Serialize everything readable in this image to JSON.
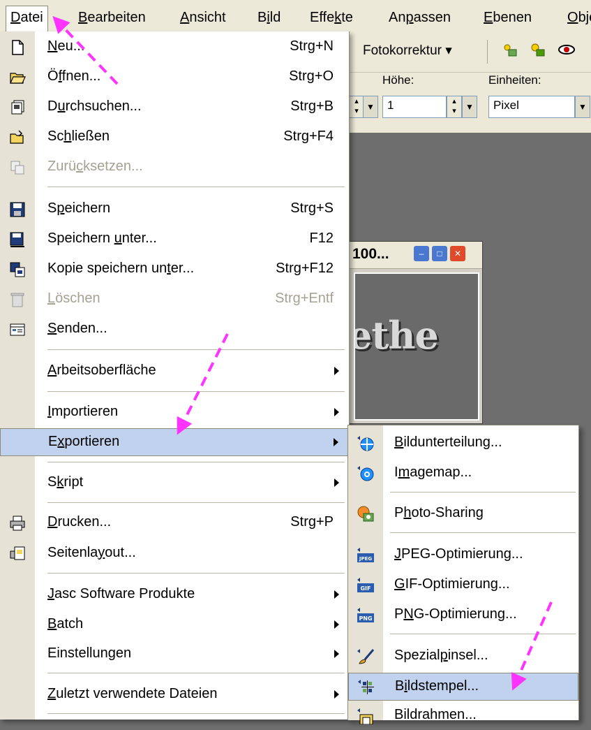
{
  "menubar": {
    "items": [
      {
        "pre": "",
        "u": "D",
        "post": "atei"
      },
      {
        "pre": "",
        "u": "B",
        "post": "earbeiten"
      },
      {
        "pre": "",
        "u": "A",
        "post": "nsicht"
      },
      {
        "pre": "B",
        "u": "i",
        "post": "ld"
      },
      {
        "pre": "Effe",
        "u": "k",
        "post": "te"
      },
      {
        "pre": "An",
        "u": "p",
        "post": "assen"
      },
      {
        "pre": "",
        "u": "E",
        "post": "benen"
      },
      {
        "pre": "",
        "u": "O",
        "post": "bje"
      }
    ]
  },
  "toolbar": {
    "fotokorrektur": "Fotokorrektur",
    "hoehe_label": "Höhe:",
    "hoehe_value": "1",
    "einheiten_label": "Einheiten:",
    "einheiten_value": "Pixel"
  },
  "document_window": {
    "title": "100...",
    "art_text": "ethe"
  },
  "file_menu": {
    "items": [
      {
        "pre": "",
        "u": "N",
        "post": "eu...",
        "shortcut": "Strg+N",
        "icon": "new-file-icon",
        "disabled": false,
        "submenu": false
      },
      {
        "pre": "Ö",
        "u": "f",
        "post": "fnen...",
        "shortcut": "Strg+O",
        "icon": "open-folder-icon",
        "disabled": false,
        "submenu": false
      },
      {
        "pre": "D",
        "u": "u",
        "post": "rchsuchen...",
        "shortcut": "Strg+B",
        "icon": "browse-icon",
        "disabled": false,
        "submenu": false
      },
      {
        "pre": "Sc",
        "u": "h",
        "post": "ließen",
        "shortcut": "Strg+F4",
        "icon": "close-folder-icon",
        "disabled": false,
        "submenu": false
      },
      {
        "pre": "Zurü",
        "u": "c",
        "post": "ksetzen...",
        "shortcut": "",
        "icon": "revert-icon",
        "disabled": true,
        "submenu": false
      },
      {
        "pre": "S",
        "u": "p",
        "post": "eichern",
        "shortcut": "Strg+S",
        "icon": "save-icon",
        "disabled": false,
        "submenu": false
      },
      {
        "pre": "Speichern ",
        "u": "u",
        "post": "nter...",
        "shortcut": "F12",
        "icon": "save-as-icon",
        "disabled": false,
        "submenu": false
      },
      {
        "pre": "Kopie speichern un",
        "u": "t",
        "post": "er...",
        "shortcut": "Strg+F12",
        "icon": "save-copy-icon",
        "disabled": false,
        "submenu": false
      },
      {
        "pre": "",
        "u": "L",
        "post": "öschen",
        "shortcut": "Strg+Entf",
        "icon": "trash-icon",
        "disabled": true,
        "submenu": false
      },
      {
        "pre": "",
        "u": "S",
        "post": "enden...",
        "shortcut": "",
        "icon": "send-icon",
        "disabled": false,
        "submenu": false
      },
      {
        "pre": "",
        "u": "A",
        "post": "rbeitsoberfläche",
        "shortcut": "",
        "icon": "",
        "disabled": false,
        "submenu": true
      },
      {
        "pre": "",
        "u": "I",
        "post": "mportieren",
        "shortcut": "",
        "icon": "",
        "disabled": false,
        "submenu": true
      },
      {
        "pre": "E",
        "u": "x",
        "post": "portieren",
        "shortcut": "",
        "icon": "",
        "disabled": false,
        "submenu": true,
        "highlight": true
      },
      {
        "pre": "S",
        "u": "k",
        "post": "ript",
        "shortcut": "",
        "icon": "",
        "disabled": false,
        "submenu": true
      },
      {
        "pre": "",
        "u": "D",
        "post": "rucken...",
        "shortcut": "Strg+P",
        "icon": "printer-icon",
        "disabled": false,
        "submenu": false
      },
      {
        "pre": "Seitenla",
        "u": "y",
        "post": "out...",
        "shortcut": "",
        "icon": "page-layout-icon",
        "disabled": false,
        "submenu": false
      },
      {
        "pre": "",
        "u": "J",
        "post": "asc Software Produkte",
        "shortcut": "",
        "icon": "",
        "disabled": false,
        "submenu": true
      },
      {
        "pre": "",
        "u": "B",
        "post": "atch",
        "shortcut": "",
        "icon": "",
        "disabled": false,
        "submenu": true
      },
      {
        "pre": "Einstellun",
        "u": "g",
        "post": "en",
        "shortcut": "",
        "icon": "",
        "disabled": false,
        "submenu": true
      },
      {
        "pre": "",
        "u": "Z",
        "post": "uletzt verwendete Dateien",
        "shortcut": "",
        "icon": "",
        "disabled": false,
        "submenu": true
      }
    ]
  },
  "export_submenu": {
    "items": [
      {
        "pre": "",
        "u": "B",
        "post": "ildunterteilung...",
        "icon": "image-slicer-icon"
      },
      {
        "pre": "I",
        "u": "m",
        "post": "agemap...",
        "icon": "imagemap-icon"
      },
      {
        "pre": "P",
        "u": "h",
        "post": "oto-Sharing",
        "icon": "photo-sharing-icon"
      },
      {
        "pre": "",
        "u": "J",
        "post": "PEG-Optimierung...",
        "icon": "jpeg-icon",
        "badge": "JPEG"
      },
      {
        "pre": "",
        "u": "G",
        "post": "IF-Optimierung...",
        "icon": "gif-icon",
        "badge": "GIF"
      },
      {
        "pre": "P",
        "u": "N",
        "post": "G-Optimierung...",
        "icon": "png-icon",
        "badge": "PNG"
      },
      {
        "pre": "Spezial",
        "u": "p",
        "post": "insel...",
        "icon": "brush-icon"
      },
      {
        "pre": "B",
        "u": "i",
        "post": "ldstempel...",
        "icon": "picture-tube-icon",
        "highlight": true
      },
      {
        "pre": "Bildrahmen...",
        "u": "",
        "post": "",
        "icon": "picture-frame-icon"
      }
    ]
  },
  "colors": {
    "annotation_arrow": "#ff33ff",
    "highlight": "#c1d2ee",
    "menu_gutter": "#e6e3d6",
    "workspace": "#6e6e6e"
  }
}
